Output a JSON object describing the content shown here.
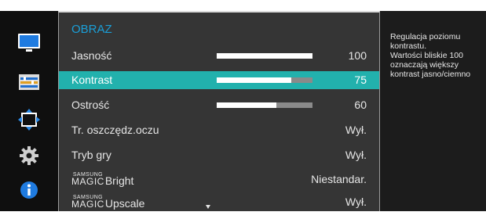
{
  "menu": {
    "title": "OBRAZ",
    "items": [
      {
        "label": "Jasność",
        "value": "100",
        "level": 100
      },
      {
        "label": "Kontrast",
        "value": "75",
        "level": 75
      },
      {
        "label": "Ostrość",
        "value": "60",
        "level": 60
      },
      {
        "label": "Tr. oszczędz.oczu",
        "value": "Wył."
      },
      {
        "label": "Tryb gry",
        "value": "Wył."
      },
      {
        "brand_small": "SAMSUNG",
        "brand_big": "MAGIC",
        "label": "Bright",
        "value": "Niestandar."
      },
      {
        "brand_small": "SAMSUNG",
        "brand_big": "MAGIC",
        "label": "Upscale",
        "value": "Wył."
      }
    ],
    "selected_index": 1
  },
  "help_text": {
    "lines": [
      "Regulacja poziomu",
      "kontrastu.",
      "Wartości bliskie 100",
      "oznaczają większy",
      "kontrast jasno/ciemno"
    ]
  },
  "icons": [
    "monitor-icon",
    "adjust-icon",
    "size-position-icon",
    "settings-gear-icon",
    "info-icon"
  ],
  "colors": {
    "selection": "#22b1ad",
    "title": "#1a9fd8",
    "panel": "#353535",
    "background": "#1c1c1c"
  }
}
